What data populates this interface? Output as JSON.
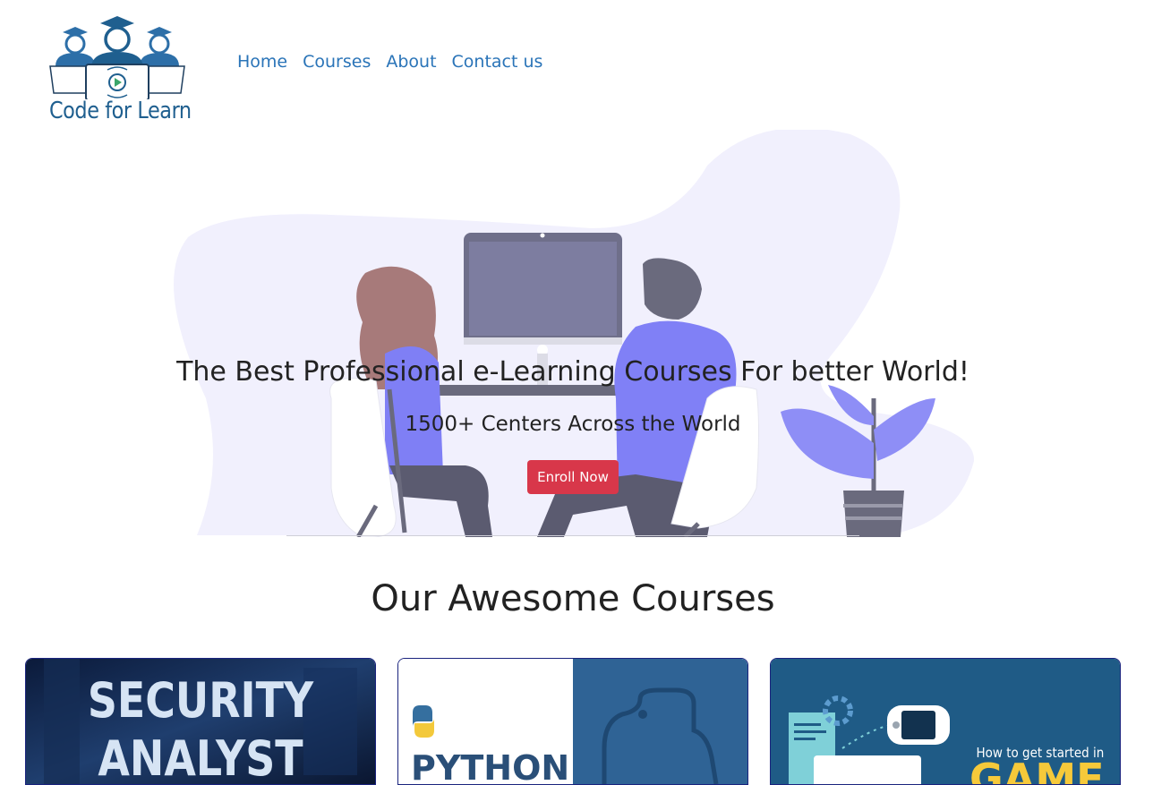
{
  "brand": {
    "name": "Code for Learn"
  },
  "nav": {
    "items": [
      "Home",
      "Courses",
      "About",
      "Contact us"
    ]
  },
  "hero": {
    "title": "The Best Professional e-Learning Courses For better World!",
    "subtitle": "1500+ Centers Across the World",
    "cta_label": "Enroll Now"
  },
  "courses_section": {
    "title": "Our Awesome Courses"
  },
  "courses": [
    {
      "image_text": [
        "SECURITY",
        "ANALYST"
      ]
    },
    {
      "image_text": [
        "PYTHON"
      ]
    },
    {
      "image_text": [
        "How to get started in",
        "GAME"
      ]
    }
  ],
  "colors": {
    "nav_link": "#2a74b8",
    "cta": "#d8374a",
    "accent_purple": "#7f7ff5",
    "blob": "#f1f0fd",
    "card_border": "#1a237e"
  }
}
